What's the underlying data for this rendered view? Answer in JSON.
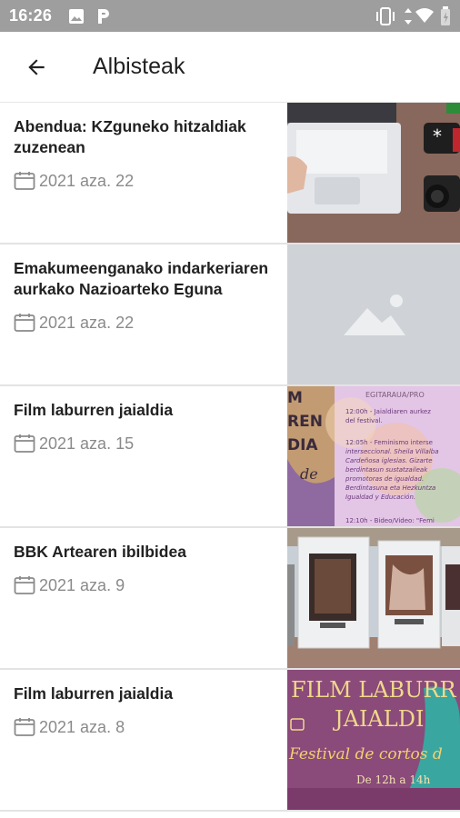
{
  "status_bar": {
    "time": "16:26",
    "icons": [
      "image-icon",
      "parking-app-icon",
      "vibrate-icon",
      "data-arrows-icon",
      "wifi-icon",
      "battery-icon"
    ]
  },
  "app_bar": {
    "back_icon": "arrow-left-icon",
    "title": "Albisteak"
  },
  "news": [
    {
      "title": "Abendua: KZguneko hitzaldiak zuzenean",
      "date": "2021 aza. 22",
      "image": "laptop-camera-photo"
    },
    {
      "title": "Emakumeenganako indarkeriaren aurkako Nazioarteko Eguna",
      "date": "2021 aza. 22",
      "image": "placeholder-image"
    },
    {
      "title": "Film laburren jaialdia",
      "date": "2021 aza. 15",
      "image": "festival-poster"
    },
    {
      "title": "BBK Artearen ibilbidea",
      "date": "2021 aza. 9",
      "image": "outdoor-exhibition-photo"
    },
    {
      "title": "Film laburren jaialdia",
      "date": "2021 aza. 8",
      "image": "film-festival-poster"
    }
  ],
  "thumb_text": {
    "item3_left": [
      "M",
      "REN",
      "DIA",
      "de"
    ],
    "item3_right_header": "EGITARAUA/PRO",
    "item3_right_lines": [
      "12:00h - Jaialdiaren aurkez",
      "del festival.",
      "12:05h - Feminismo interse",
      "interseccional. Sheila Villalba",
      "Cardeñosa iglesias. Gizarte",
      "berdintasun sustatzaileak",
      "promotoras de igualdad.",
      "Berdintasuna eta Hezkuntza",
      "Igualdad y Educación.",
      "12:10h - Bideo/Video: \"Femi"
    ],
    "item5_line1": "FILM LABURR",
    "item5_line2": "JAIALDI",
    "item5_line3": "Festival de cortos d",
    "item5_line4": "De 12h a 14h"
  }
}
